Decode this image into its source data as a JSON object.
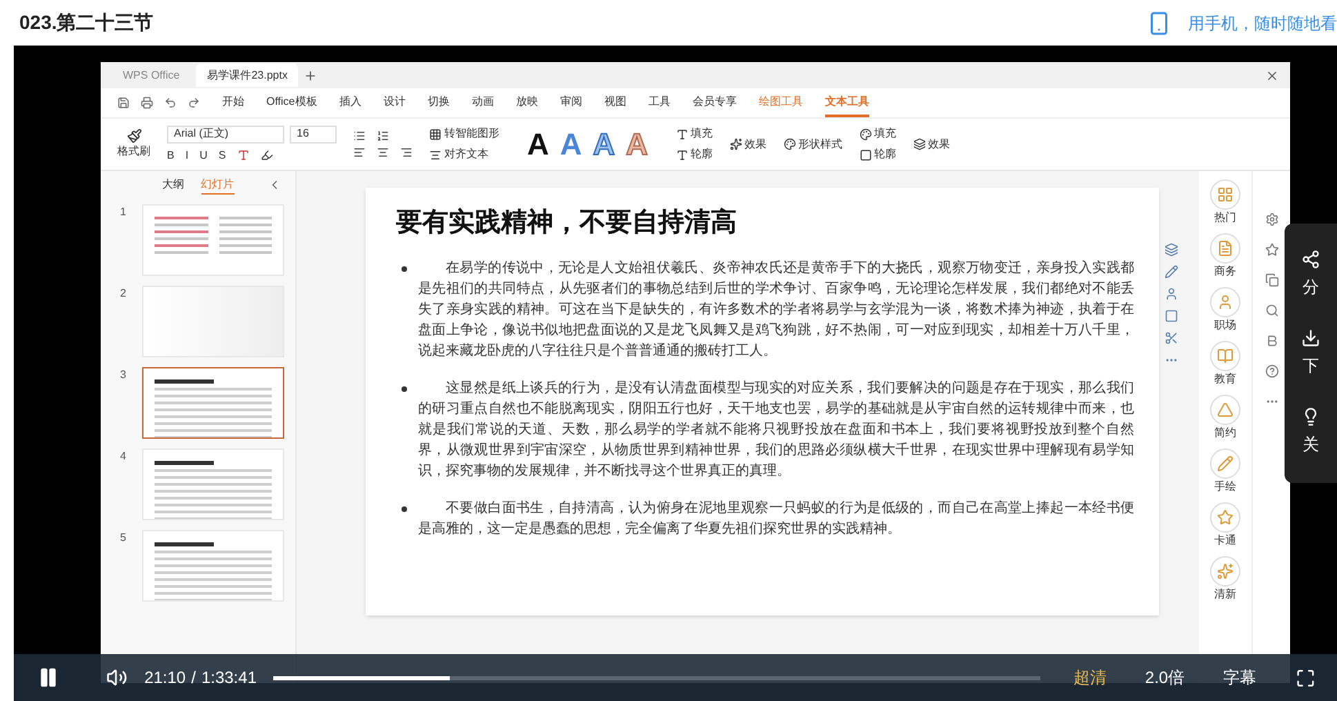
{
  "page": {
    "title": "023.第二十三节",
    "mobile_link": "用手机，随时随地看"
  },
  "app": {
    "tabs": [
      {
        "label": "WPS Office",
        "selected": false
      },
      {
        "label": "易学课件23.pptx",
        "selected": true
      }
    ],
    "menu": [
      {
        "label": "开始",
        "kind": "normal",
        "selected": false
      },
      {
        "label": "Office模板",
        "kind": "normal",
        "selected": false
      },
      {
        "label": "插入",
        "kind": "normal",
        "selected": false
      },
      {
        "label": "设计",
        "kind": "normal",
        "selected": false
      },
      {
        "label": "切换",
        "kind": "normal",
        "selected": false
      },
      {
        "label": "动画",
        "kind": "normal",
        "selected": false
      },
      {
        "label": "放映",
        "kind": "normal",
        "selected": false
      },
      {
        "label": "审阅",
        "kind": "normal",
        "selected": false
      },
      {
        "label": "视图",
        "kind": "normal",
        "selected": false
      },
      {
        "label": "工具",
        "kind": "normal",
        "selected": false
      },
      {
        "label": "会员专享",
        "kind": "normal",
        "selected": false
      },
      {
        "label": "绘图工具",
        "kind": "context",
        "selected": false
      },
      {
        "label": "文本工具",
        "kind": "context",
        "selected": true
      }
    ],
    "ribbon": {
      "format_painter": "格式刷",
      "font": "Arial (正文)",
      "size": "16",
      "format_letters": [
        "B",
        "I",
        "U",
        "S"
      ],
      "smart_art": "转智能图形",
      "align_text": "对齐文本",
      "text_styles": [
        {
          "letter": "A",
          "kind": "solid"
        },
        {
          "letter": "A",
          "kind": "blue"
        },
        {
          "letter": "A",
          "kind": "outline"
        },
        {
          "letter": "A",
          "kind": "light"
        }
      ],
      "text_fill": "填充",
      "text_outline": "轮廓",
      "text_effect": "效果",
      "shape_style": "形状样式",
      "shape_fill": "填充",
      "shape_outline": "轮廓",
      "shape_effect": "效果"
    },
    "pane_tabs": [
      {
        "label": "大纲",
        "selected": false
      },
      {
        "label": "幻灯片",
        "selected": true
      }
    ],
    "thumbnails": [
      {
        "number": "1",
        "selected": false,
        "kind": "contents"
      },
      {
        "number": "2",
        "selected": false,
        "kind": "cover"
      },
      {
        "number": "3",
        "selected": true,
        "kind": "text"
      },
      {
        "number": "4",
        "selected": false,
        "kind": "text"
      },
      {
        "number": "5",
        "selected": false,
        "kind": "text"
      }
    ],
    "slide": {
      "title": "要有实践精神，不要自持清高",
      "paragraphs": [
        "在易学的传说中，无论是人文始祖伏羲氏、炎帝神农氏还是黄帝手下的大挠氏，观察万物变迁，亲身投入实践都是先祖们的共同特点，从先驱者们的事物总结到后世的学术争讨、百家争鸣，无论理论怎样发展，我们都绝对不能丢失了亲身实践的精神。可这在当下是缺失的，有许多数术的学者将易学与玄学混为一谈，将数术捧为神迹，执着于在盘面上争论，像说书似地把盘面说的又是龙飞凤舞又是鸡飞狗跳，好不热闹，可一对应到现实，却相差十万八千里，说起来藏龙卧虎的八字往往只是个普普通通的搬砖打工人。",
        "这显然是纸上谈兵的行为，是没有认清盘面模型与现实的对应关系，我们要解决的问题是存在于现实，那么我们的研习重点自然也不能脱离现实，阴阳五行也好，天干地支也罢，易学的基础就是从宇宙自然的运转规律中而来，也就是我们常说的天道、天数，那么易学的学者就不能将只视野投放在盘面和书本上，我们要将视野投放到整个自然界，从微观世界到宇宙深空，从物质世界到精神世界，我们的思路必须纵横大千世界，在现实世界中理解现有易学知识，探究事物的发展规律，并不断找寻这个世界真正的真理。",
        "不要做白面书生，自持清高，认为俯身在泥地里观察一只蚂蚁的行为是低级的，而自己在高堂上捧起一本经书便是高雅的，这一定是愚蠢的思想，完全偏离了华夏先祖们探究世界的实践精神。"
      ]
    },
    "template_categories": [
      "热门",
      "商务",
      "职场",
      "教育",
      "简约",
      "手绘",
      "卡通",
      "清新"
    ]
  },
  "side_panel": [
    {
      "kind": "share",
      "label": "分"
    },
    {
      "kind": "download",
      "label": "下"
    },
    {
      "kind": "light",
      "label": "关"
    }
  ],
  "player": {
    "playing": true,
    "current": "21:10",
    "separator": "/",
    "total": "1:33:41",
    "level": 0.23,
    "quality": "超清",
    "speed": "2.0倍",
    "subtitles": "字幕"
  }
}
